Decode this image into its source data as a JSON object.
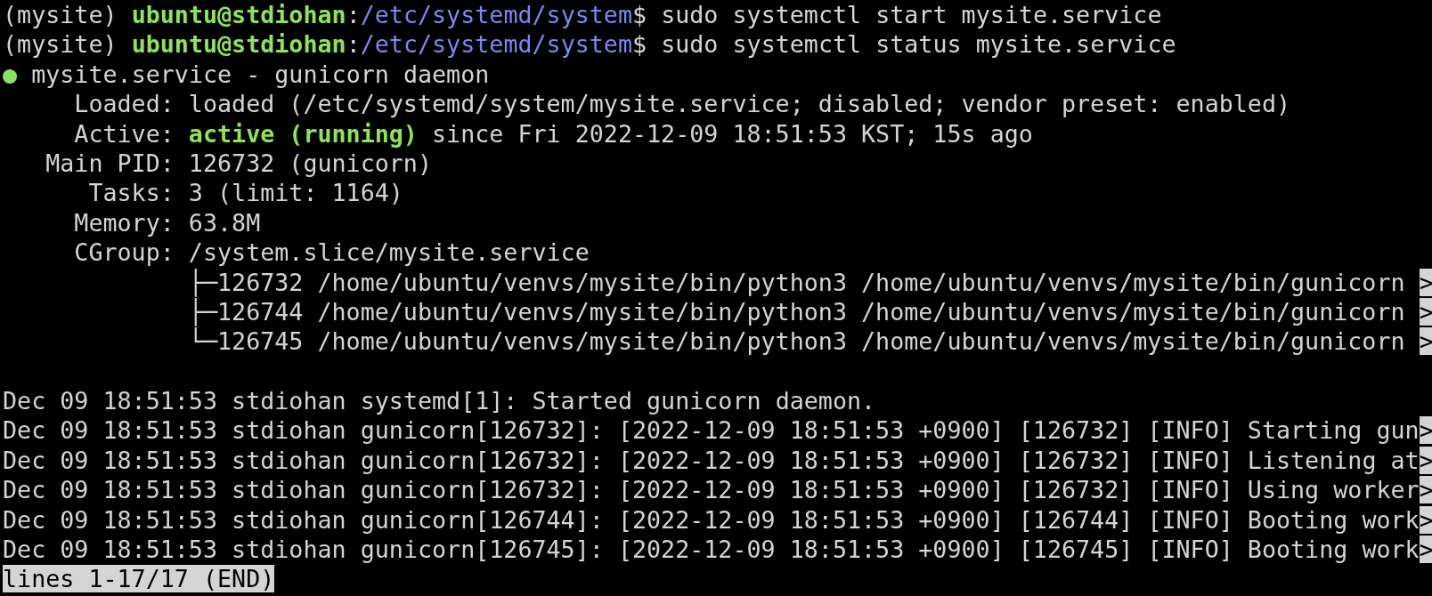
{
  "prompts": [
    {
      "env": "(mysite)",
      "user_host": "ubuntu@stdiohan",
      "sep": ":",
      "path": "/etc/systemd/system",
      "symbol": "$",
      "command": "sudo systemctl start mysite.service"
    },
    {
      "env": "(mysite)",
      "user_host": "ubuntu@stdiohan",
      "sep": ":",
      "path": "/etc/systemd/system",
      "symbol": "$",
      "command": "sudo systemctl status mysite.service"
    }
  ],
  "unit": {
    "dot": "●",
    "title": "mysite.service - gunicorn daemon"
  },
  "fields": [
    {
      "kind": "plain",
      "label": "Loaded:",
      "value": "loaded (/etc/systemd/system/mysite.service; disabled; vendor preset: enabled)"
    },
    {
      "kind": "active",
      "label": "Active:",
      "state": "active (running)",
      "value": "since Fri 2022-12-09 18:51:53 KST; 15s ago"
    },
    {
      "kind": "plain",
      "label": "Main PID:",
      "value": "126732 (gunicorn)"
    },
    {
      "kind": "plain",
      "label": "Tasks:",
      "value": "3 (limit: 1164)"
    },
    {
      "kind": "plain",
      "label": "Memory:",
      "value": "63.8M"
    },
    {
      "kind": "tree",
      "label": "CGroup:",
      "value": "/system.slice/mysite.service",
      "children": [
        {
          "branch": "├─",
          "text": "126732 /home/ubuntu/venvs/mysite/bin/python3 /home/ubuntu/venvs/mysite/bin/gunicorn ",
          "more": ">"
        },
        {
          "branch": "├─",
          "text": "126744 /home/ubuntu/venvs/mysite/bin/python3 /home/ubuntu/venvs/mysite/bin/gunicorn ",
          "more": ">"
        },
        {
          "branch": "└─",
          "text": "126745 /home/ubuntu/venvs/mysite/bin/python3 /home/ubuntu/venvs/mysite/bin/gunicorn ",
          "more": ">"
        }
      ]
    }
  ],
  "log": [
    {
      "text": "Dec 09 18:51:53 stdiohan systemd[1]: Started gunicorn daemon."
    },
    {
      "text": "Dec 09 18:51:53 stdiohan gunicorn[126732]: [2022-12-09 18:51:53 +0900] [126732] [INFO] Starting gun",
      "more": ">"
    },
    {
      "text": "Dec 09 18:51:53 stdiohan gunicorn[126732]: [2022-12-09 18:51:53 +0900] [126732] [INFO] Listening at",
      "more": ">"
    },
    {
      "text": "Dec 09 18:51:53 stdiohan gunicorn[126732]: [2022-12-09 18:51:53 +0900] [126732] [INFO] Using worker",
      "more": ">"
    },
    {
      "text": "Dec 09 18:51:53 stdiohan gunicorn[126744]: [2022-12-09 18:51:53 +0900] [126744] [INFO] Booting work",
      "more": ">"
    },
    {
      "text": "Dec 09 18:51:53 stdiohan gunicorn[126745]: [2022-12-09 18:51:53 +0900] [126745] [INFO] Booting work",
      "more": ">"
    }
  ],
  "pager_status": "lines 1-17/17 (END)"
}
